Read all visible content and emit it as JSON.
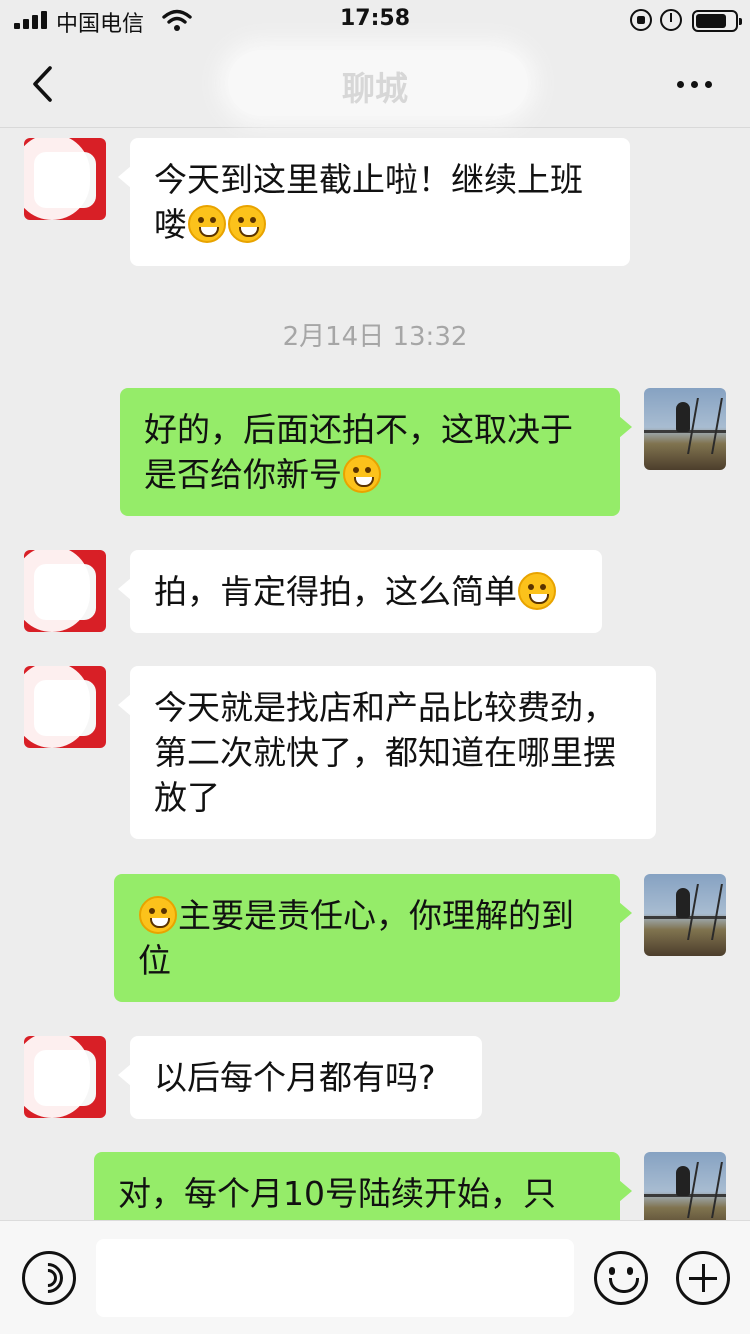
{
  "status_bar": {
    "carrier": "中国电信",
    "time": "17:58",
    "battery_level": 0.8
  },
  "header": {
    "title": "聊城",
    "back_icon": "chevron-left-icon",
    "more_icon": "more-dots-icon"
  },
  "messages": [
    {
      "sender": "other",
      "text": "今天到这里截止啦！继续上班喽",
      "emoji": "salute-face-emoji",
      "emoji_count": 2
    },
    {
      "type": "timestamp",
      "text": "2月14日 13:32"
    },
    {
      "sender": "me",
      "text": "好的，后面还拍不，这取决于是否给你新号",
      "emoji": "tears-of-joy-emoji"
    },
    {
      "sender": "other",
      "text": "拍，肯定得拍，这么简单",
      "emoji": "grinning-face-emoji"
    },
    {
      "sender": "other",
      "text": "今天就是找店和产品比较费劲，第二次就快了，都知道在哪里摆放了"
    },
    {
      "sender": "me",
      "text": "主要是责任心，你理解的到位",
      "emoji": "grinning-face-emoji"
    },
    {
      "sender": "other",
      "text": "以后每个月都有吗?"
    },
    {
      "sender": "me",
      "text": "对，每个月10号陆续开始，只"
    }
  ],
  "input_bar": {
    "placeholder": "",
    "voice_icon": "voice-icon",
    "emoji_icon": "emoji-face-icon",
    "plus_icon": "plus-icon"
  },
  "colors": {
    "background": "#ededed",
    "my_bubble": "#95ec69",
    "other_bubble": "#ffffff",
    "timestamp_text": "#a6a6a6"
  }
}
